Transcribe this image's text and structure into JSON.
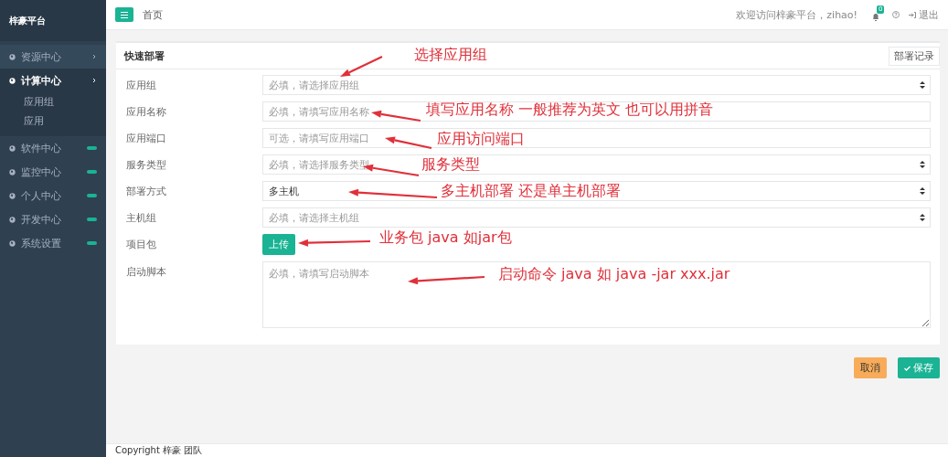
{
  "sidebar": {
    "title": "梓豪平台",
    "items": [
      {
        "label": "资源中心",
        "kind": "submenu",
        "expanded": false
      },
      {
        "label": "计算中心",
        "kind": "submenu",
        "expanded": true,
        "children": [
          {
            "label": "应用组"
          },
          {
            "label": "应用"
          }
        ]
      },
      {
        "label": "软件中心",
        "kind": "badge",
        "expanded": false
      },
      {
        "label": "监控中心",
        "kind": "badge",
        "expanded": false
      },
      {
        "label": "个人中心",
        "kind": "badge",
        "expanded": false
      },
      {
        "label": "开发中心",
        "kind": "badge",
        "expanded": false
      },
      {
        "label": "系统设置",
        "kind": "badge",
        "expanded": false
      }
    ]
  },
  "topbar": {
    "page_title": "首页",
    "welcome": "欢迎访问梓豪平台，zihao!",
    "notification_count": "0",
    "logout": "退出"
  },
  "form": {
    "title": "快速部署",
    "history_button": "部署记录",
    "fields": [
      {
        "label": "应用组",
        "kind": "select",
        "placeholder": "必填，请选择应用组"
      },
      {
        "label": "应用名称",
        "kind": "input",
        "placeholder": "必填，请填写应用名称"
      },
      {
        "label": "应用端口",
        "kind": "input",
        "placeholder": "可选，请填写应用端口"
      },
      {
        "label": "服务类型",
        "kind": "select",
        "placeholder": "必填，请选择服务类型"
      },
      {
        "label": "部署方式",
        "kind": "select",
        "value": "多主机"
      },
      {
        "label": "主机组",
        "kind": "select",
        "placeholder": "必填，请选择主机组"
      },
      {
        "label": "项目包",
        "kind": "upload",
        "button": "上传"
      },
      {
        "label": "启动脚本",
        "kind": "textarea",
        "placeholder": "必填，请填写启动脚本"
      }
    ]
  },
  "actions": {
    "cancel": "取消",
    "save": "保存"
  },
  "annotations": [
    "选择应用组",
    "填写应用名称 一般推荐为英文 也可以用拼音",
    "应用访问端口",
    "服务类型",
    "多主机部署 还是单主机部署",
    "业务包 java 如jar包",
    "启动命令 java 如 java -jar xxx.jar"
  ],
  "footer": {
    "copyright": "Copyright 梓豪 团队"
  }
}
